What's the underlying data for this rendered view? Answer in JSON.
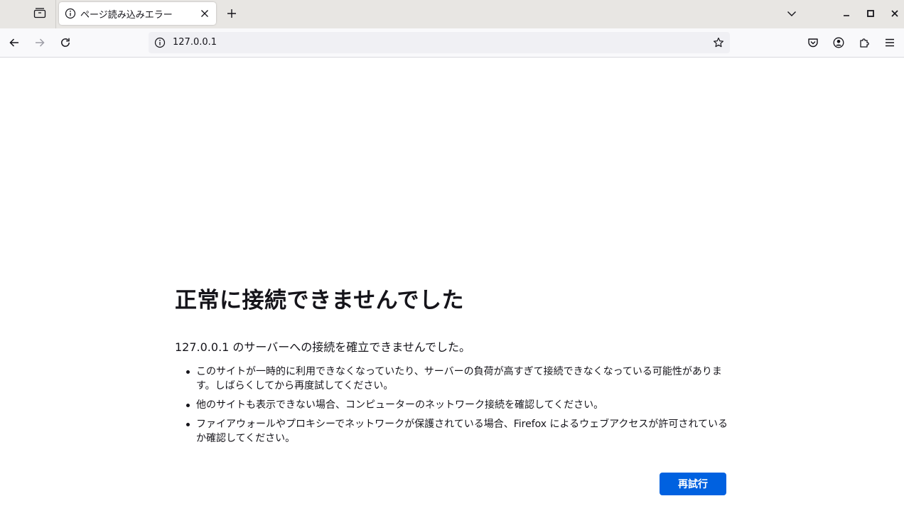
{
  "tab": {
    "title": "ページ読み込みエラー"
  },
  "urlbar": {
    "url": "127.0.0.1"
  },
  "error": {
    "title": "正常に接続できませんでした",
    "description": "127.0.0.1 のサーバーへの接続を確立できませんでした。",
    "items": [
      "このサイトが一時的に利用できなくなっていたり、サーバーの負荷が高すぎて接続できなくなっている可能性があります。しばらくしてから再度試してください。",
      "他のサイトも表示できない場合、コンピューターのネットワーク接続を確認してください。",
      "ファイアウォールやプロキシーでネットワークが保護されている場合、Firefox によるウェブアクセスが許可されているか確認してください。"
    ],
    "retry_label": "再試行"
  },
  "icons": {
    "tab_overview": "tab-overview-icon",
    "info": "info-icon",
    "close": "close-icon",
    "new_tab": "plus-icon",
    "list_all_tabs": "chevron-down-icon",
    "minimize": "minimize-icon",
    "maximize": "maximize-icon",
    "window_close": "window-close-icon",
    "back": "back-arrow-icon",
    "forward": "forward-arrow-icon",
    "reload": "reload-icon",
    "bookmark": "star-icon",
    "pocket": "pocket-icon",
    "account": "account-icon",
    "extensions": "extensions-icon",
    "menu": "hamburger-menu-icon"
  },
  "colors": {
    "accent": "#0061e0",
    "tabbar_bg": "#e8e6e3",
    "navbar_bg": "#f9f9fb",
    "urlbar_bg": "#f0f0f4",
    "text": "#15141a"
  }
}
